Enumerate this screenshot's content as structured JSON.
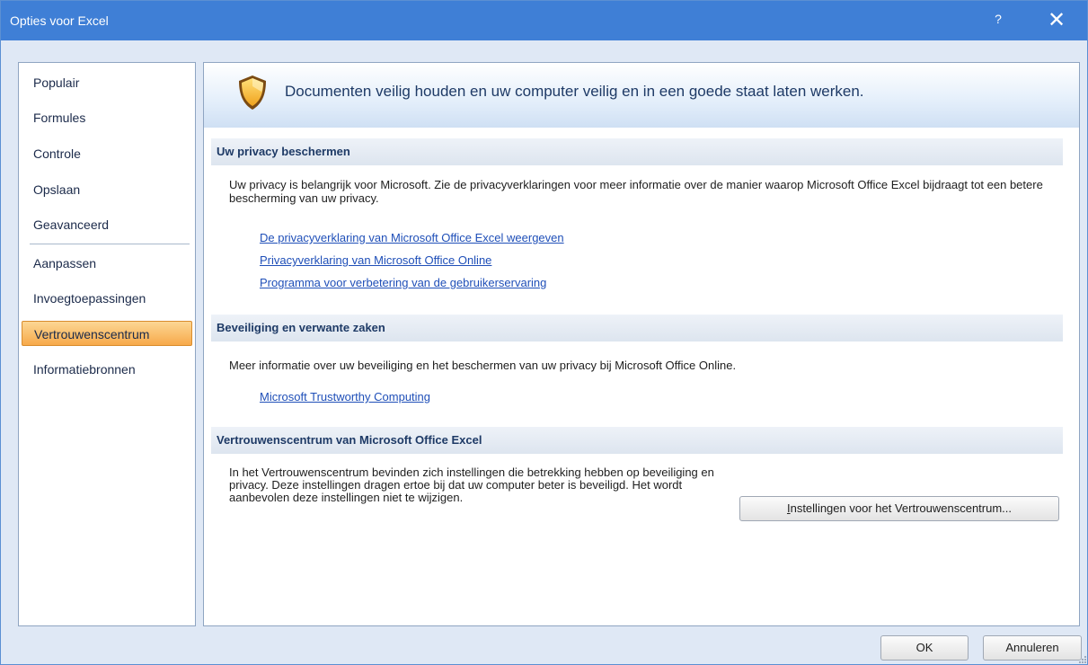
{
  "window": {
    "title": "Opties voor Excel",
    "help_label": "?",
    "close_label": "✕"
  },
  "sidebar": {
    "items": [
      {
        "label": "Populair"
      },
      {
        "label": "Formules"
      },
      {
        "label": "Controle"
      },
      {
        "label": "Opslaan"
      },
      {
        "label": "Geavanceerd"
      },
      {
        "label": "Aanpassen"
      },
      {
        "label": "Invoegtoepassingen"
      },
      {
        "label": "Vertrouwenscentrum",
        "selected": true
      },
      {
        "label": "Informatiebronnen"
      }
    ]
  },
  "banner": {
    "icon": "shield-icon",
    "text": "Documenten veilig houden en uw computer veilig en in een goede staat laten werken."
  },
  "privacy": {
    "header": "Uw privacy beschermen",
    "text": "Uw privacy is belangrijk voor Microsoft. Zie de privacyverklaringen voor meer informatie over de manier waarop Microsoft Office Excel bijdraagt tot een betere bescherming van uw privacy.",
    "links": [
      "De privacyverklaring van Microsoft Office Excel weergeven",
      "Privacyverklaring van Microsoft Office Online",
      "Programma voor verbetering van de gebruikerservaring"
    ]
  },
  "security": {
    "header": "Beveiliging en verwante zaken",
    "text": "Meer informatie over uw beveiliging en het beschermen van uw privacy bij Microsoft Office Online.",
    "link": "Microsoft Trustworthy Computing"
  },
  "trust_center": {
    "header": "Vertrouwenscentrum van Microsoft Office Excel",
    "text": "In het Vertrouwenscentrum bevinden zich instellingen die betrekking hebben op beveiliging en privacy. Deze instellingen dragen ertoe bij dat uw computer beter is beveiligd. Het wordt aanbevolen deze instellingen niet te wijzigen.",
    "button_underlined": "I",
    "button_rest": "nstellingen voor het Vertrouwenscentrum..."
  },
  "footer": {
    "ok_label": "OK",
    "cancel_label": "Annuleren"
  },
  "colors": {
    "titlebar": "#3f7fd6",
    "selected_item": "#f7a94a",
    "link": "#1f4fb8",
    "section_header_text": "#1e3a66"
  }
}
